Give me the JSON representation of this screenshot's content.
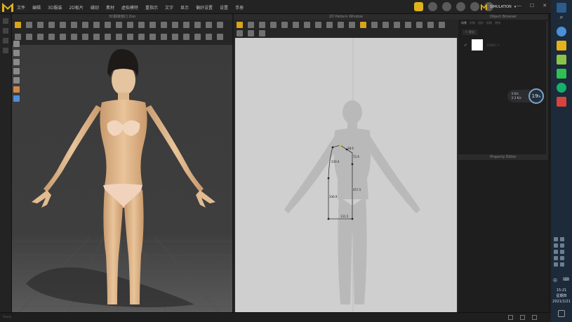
{
  "menubar": {
    "items": [
      "文件",
      "编辑",
      "3D服装",
      "2D板片",
      "缝纫",
      "素材",
      "虚拟模特",
      "重指示",
      "文字",
      "显示",
      "偏好设置",
      "设置",
      "手册"
    ],
    "simulation_label": "SIMULATION"
  },
  "viewport3d": {
    "title": "3D服装窗口 Zoo"
  },
  "window2d": {
    "title": "2D Pattern Window",
    "measures": [
      "28.6",
      "72.6",
      "230.4",
      "457.5",
      "336.9",
      "131.5"
    ]
  },
  "object_browser": {
    "title": "Object Browser",
    "tabs": [
      "场景",
      "织物",
      "纽扣",
      "扣眼",
      "明线"
    ],
    "add_label": "+ 增加",
    "fabric_name": "FABRIC 1"
  },
  "gauge": {
    "value": "19",
    "unit": "%",
    "row1": "0 K/s",
    "row2": "0.3 K/s"
  },
  "property_editor": {
    "title": "Property Editor"
  },
  "statusbar": {
    "text": "Ready"
  },
  "taskbar": {
    "ime": "中",
    "time": "15:21",
    "weekday": "星期四",
    "date": "2021/1/21"
  },
  "colors": {
    "accent": "#e0b21a",
    "board": "#cfcfcf",
    "viewport": "#3a3a3a"
  }
}
